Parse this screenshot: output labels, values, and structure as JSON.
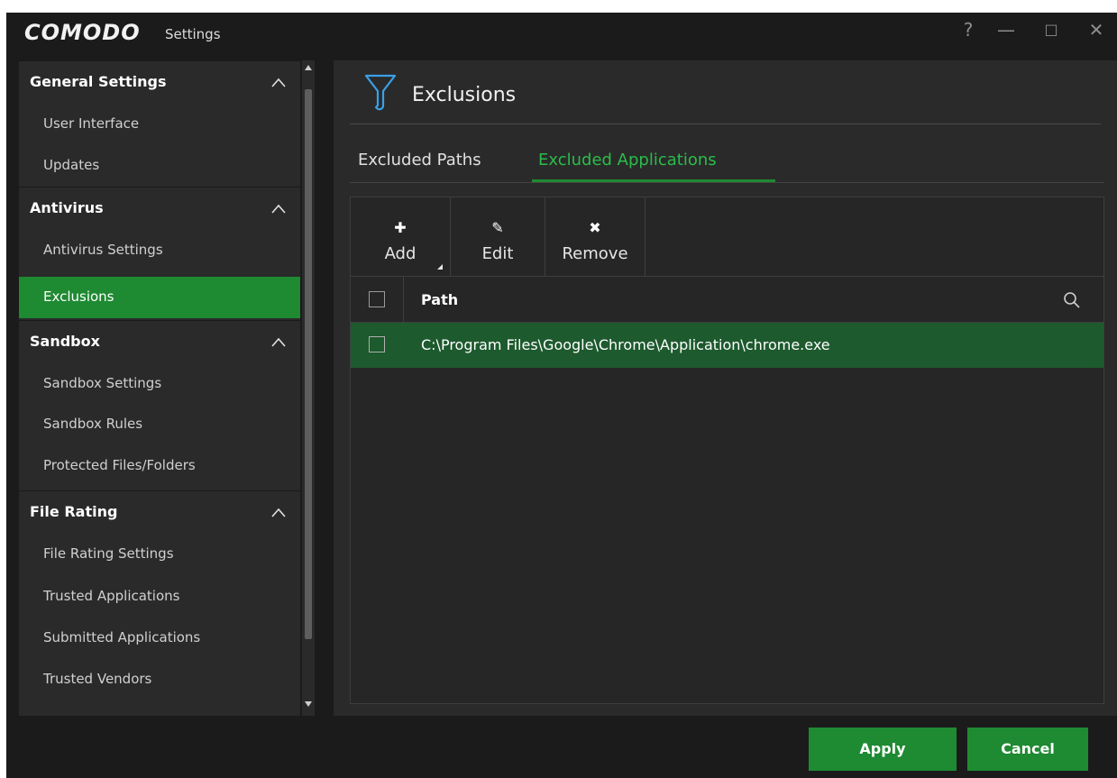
{
  "app": {
    "logo": "COMODO",
    "subtitle": "Settings"
  },
  "window_controls": {
    "help": "?",
    "minimize": "—",
    "maximize": "□",
    "close": "✕"
  },
  "sidebar": {
    "sections": [
      {
        "label": "General Settings",
        "items": [
          "User Interface",
          "Updates"
        ]
      },
      {
        "label": "Antivirus",
        "items": [
          "Antivirus Settings",
          "Exclusions"
        ]
      },
      {
        "label": "Sandbox",
        "items": [
          "Sandbox Settings",
          "Sandbox Rules",
          "Protected Files/Folders"
        ]
      },
      {
        "label": "File Rating",
        "items": [
          "File Rating Settings",
          "Trusted Applications",
          "Submitted Applications",
          "Trusted Vendors"
        ]
      }
    ],
    "active_item": "Exclusions"
  },
  "main": {
    "title": "Exclusions",
    "tabs": [
      {
        "label": "Excluded Paths",
        "active": false
      },
      {
        "label": "Excluded Applications",
        "active": true
      }
    ],
    "toolbar": {
      "add": "Add",
      "edit": "Edit",
      "remove": "Remove"
    },
    "table": {
      "column": "Path",
      "rows": [
        "C:\\Program Files\\Google\\Chrome\\Application\\chrome.exe"
      ]
    }
  },
  "footer": {
    "apply": "Apply",
    "cancel": "Cancel"
  },
  "colors": {
    "accent": "#1e8a32",
    "selected_row": "#1d5a2e",
    "active_tab_text": "#2bbd4a",
    "background": "#1b1b1b",
    "panel": "#2a2a2a"
  }
}
